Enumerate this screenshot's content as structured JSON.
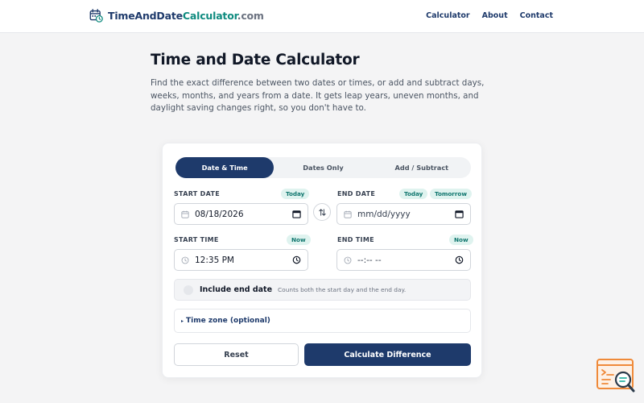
{
  "header": {
    "logo_part1": "TimeAndDate",
    "logo_part2": "Calculator",
    "logo_part3": ".com",
    "nav": [
      "Calculator",
      "About",
      "Contact"
    ]
  },
  "page": {
    "title": "Time and Date Calculator",
    "intro": "Find the exact difference between two dates or times, or add and subtract days, weeks, months, and years from a date. It gets leap years, uneven months, and daylight saving changes right, so you don't have to."
  },
  "calculator": {
    "tabs": [
      "Date & Time",
      "Dates Only",
      "Add / Subtract"
    ],
    "active_tab": 0,
    "start_date": {
      "label": "START DATE",
      "chip": "Today",
      "value": "08/18/2026"
    },
    "end_date": {
      "label": "END DATE",
      "chips": [
        "Today",
        "Tomorrow"
      ],
      "placeholder": "mm/dd/yyyy"
    },
    "start_time": {
      "label": "START TIME",
      "chip": "Now",
      "value": "12:35 PM"
    },
    "end_time": {
      "label": "END TIME",
      "chip": "Now",
      "placeholder": "--:-- --"
    },
    "include_end": {
      "label": "Include end date",
      "hint": "Counts both the start day and the end day.",
      "checked": false
    },
    "timezone": {
      "label": "Time zone (optional)",
      "arrow": "▸"
    },
    "reset_label": "Reset",
    "calculate_label": "Calculate Difference"
  },
  "colors": {
    "primary": "#1e3a6b",
    "teal": "#0f8b7f",
    "chip_bg": "#dff3ef",
    "page_bg": "#f4f4f5"
  },
  "icons": {
    "logo": "calendar-clock-icon",
    "swap": "swap-arrows-icon",
    "date": "calendar-icon",
    "time": "clock-icon",
    "corner": "search-code-icon"
  }
}
